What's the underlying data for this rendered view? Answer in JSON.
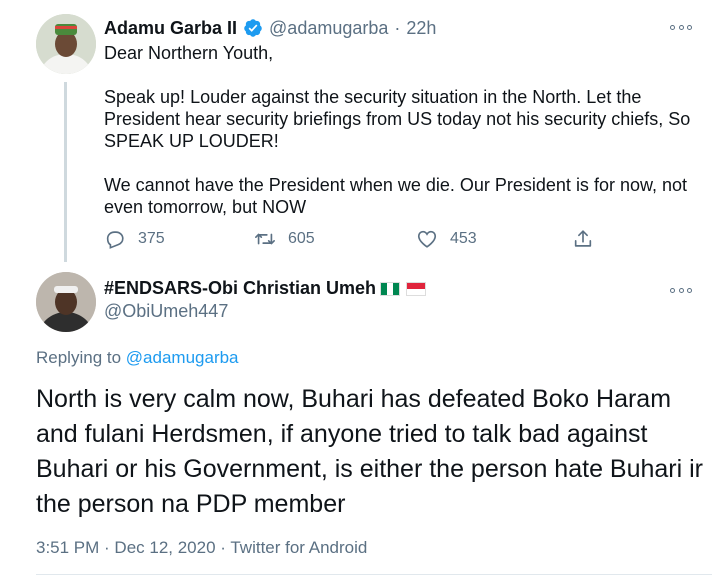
{
  "tweet1": {
    "display_name": "Adamu Garba II",
    "handle": "@adamugarba",
    "separator": "·",
    "time": "22h",
    "lines": [
      "Dear Northern Youth,",
      "",
      "Speak up! Louder against the security situation in the North. Let the",
      "President hear security briefings from US today not his security chiefs, So",
      "SPEAK UP LOUDER!",
      "",
      "We cannot have the President when we die. Our President is for now, not",
      "even tomorrow, but NOW"
    ],
    "reply_count": "375",
    "retweet_count": "605",
    "like_count": "453",
    "icons": {
      "verified": "verified-badge-icon",
      "reply": "reply-icon",
      "retweet": "retweet-icon",
      "like": "heart-icon",
      "share": "share-icon",
      "more": "more-options-icon"
    }
  },
  "tweet2": {
    "display_name": "#ENDSARS-Obi Christian Umeh",
    "handle": "@ObiUmeh447",
    "flags": [
      "nigeria-flag-icon",
      "indonesia-flag-icon"
    ],
    "replying_prefix": "Replying to",
    "replying_to": "@adamugarba",
    "body": "North is very calm now, Buhari has defeated Boko Haram and fulani Herdsmen, if anyone tried to talk bad against Buhari or his Government, is either the person hate Buhari ir the person na PDP member",
    "timestamp": "3:51 PM · Dec 12, 2020 · Twitter for Android"
  },
  "colors": {
    "accent": "#1d9bf0",
    "secondary_text": "#5b7083",
    "primary_text": "#0f1419",
    "nigeria_green": "#008751",
    "indonesia_red": "#e0243c"
  }
}
